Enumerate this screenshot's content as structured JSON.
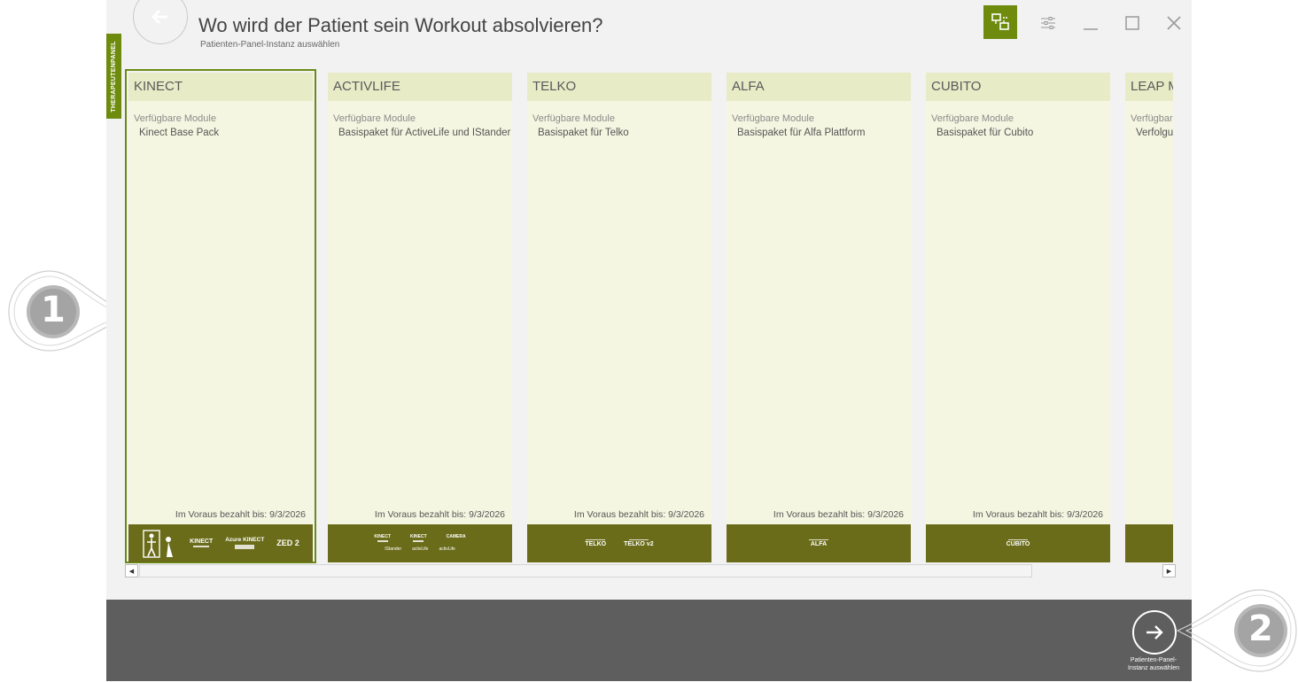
{
  "header": {
    "title": "Wo wird der Patient sein Workout absolvieren?",
    "subtitle": "Patienten-Panel-Instanz auswählen"
  },
  "side_tab": "THERAPEUTENPANEL",
  "module_label": "Verfügbare Module",
  "paid_label": "Im Voraus bezahlt bis: 9/3/2026",
  "cards": [
    {
      "title": "KINECT",
      "module": "Kinect Base Pack",
      "selected": true,
      "logos": [
        "KINECT",
        "Azure KINECT",
        "ZED 2"
      ]
    },
    {
      "title": "ACTIVLIFE",
      "module": "Basispaket für ActiveLife und IStander",
      "logos": [
        "KINECT",
        "KINECT",
        "CAMERA"
      ]
    },
    {
      "title": "TELKO",
      "module": "Basispaket für Telko",
      "logos": [
        "TELKO",
        "TELKO v2"
      ]
    },
    {
      "title": "ALFA",
      "module": "Basispaket für Alfa Plattform",
      "logos": [
        "ALFA"
      ]
    },
    {
      "title": "CUBITO",
      "module": "Basispaket für Cubito",
      "logos": [
        "CUBITO"
      ]
    },
    {
      "title": "LEAP M",
      "module": "Verfolgu",
      "logos": []
    }
  ],
  "sub_logos": {
    "activlife": [
      "IStander",
      "activLife",
      "activLife"
    ]
  },
  "footer": {
    "next_label_line1": "Patienten-Panel-",
    "next_label_line2": "Instanz auswählen"
  },
  "callouts": [
    "1",
    "2"
  ],
  "colors": {
    "accent": "#6e8b0e",
    "card_bg": "#f5f6e1",
    "card_head": "#e7ebc6",
    "card_foot": "#6a6c19",
    "bottom_bar": "#5e5e5e"
  },
  "icons": [
    "arrow-left-icon",
    "screens-icon",
    "settings-sliders-icon",
    "minimize-icon",
    "maximize-icon",
    "close-icon",
    "arrow-right-icon"
  ]
}
